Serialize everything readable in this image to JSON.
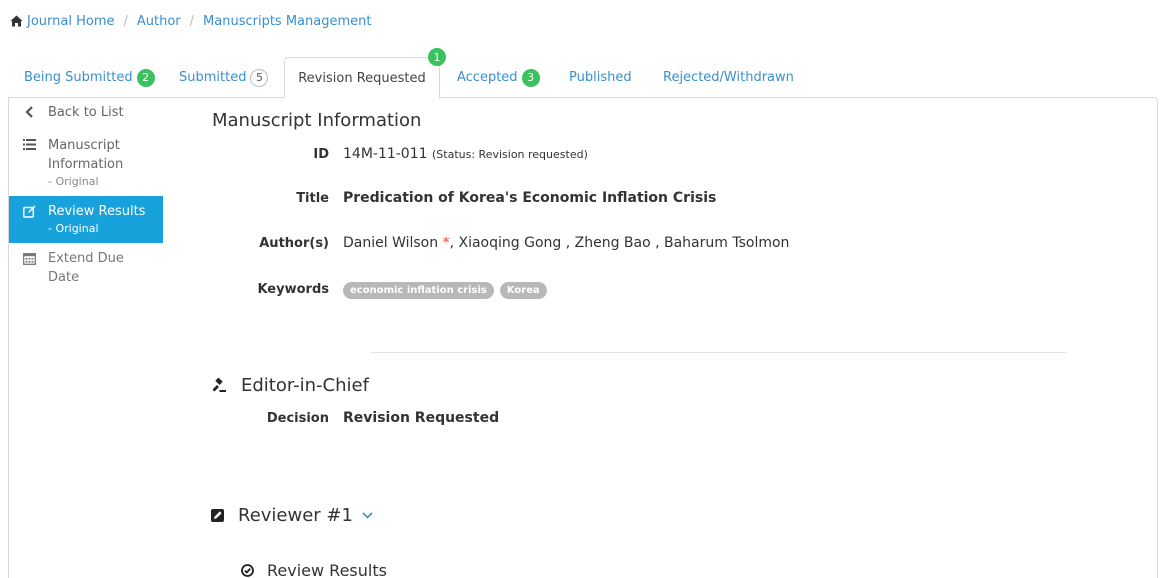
{
  "breadcrumb": {
    "home": "Journal Home",
    "author": "Author",
    "manuscripts": "Manuscripts Management"
  },
  "tabs": {
    "being_submitted": {
      "label": "Being Submitted",
      "count": "2"
    },
    "submitted": {
      "label": "Submitted",
      "count": "5"
    },
    "revision_requested": {
      "label": "Revision Requested",
      "count": "1"
    },
    "accepted": {
      "label": "Accepted",
      "count": "3"
    },
    "published": {
      "label": "Published"
    },
    "rejected": {
      "label": "Rejected/Withdrawn"
    }
  },
  "sidebar": {
    "back": "Back to List",
    "manuscript_info": {
      "label": "Manuscript Information",
      "sub": "- Original"
    },
    "review_results": {
      "label": "Review Results",
      "sub": "- Original"
    },
    "extend_due": "Extend Due Date"
  },
  "manuscript": {
    "section_title": "Manuscript Information",
    "id_label": "ID",
    "id_value": "14M-11-011",
    "status_text": "(Status: Revision requested)",
    "title_label": "Title",
    "title_value": "Predication of Korea's Economic Inflation Crisis",
    "authors_label": "Author(s)",
    "corresponding_author": "Daniel Wilson",
    "corresponding_mark": "*",
    "other_authors": ", Xiaoqing Gong , Zheng Bao , Baharum Tsolmon",
    "keywords_label": "Keywords",
    "keywords": [
      "economic inflation crisis",
      "Korea"
    ]
  },
  "editor": {
    "section_title": "Editor-in-Chief",
    "decision_label": "Decision",
    "decision_value": "Revision Requested"
  },
  "reviewer": {
    "section_title": "Reviewer #1",
    "review_results": "Review Results"
  },
  "colors": {
    "link": "#3a8fd0",
    "active_sidebar": "#17a2dc",
    "badge_green": "#3cc15f",
    "required_star": "#e04545",
    "keyword_tag": "#b8b8b8"
  }
}
